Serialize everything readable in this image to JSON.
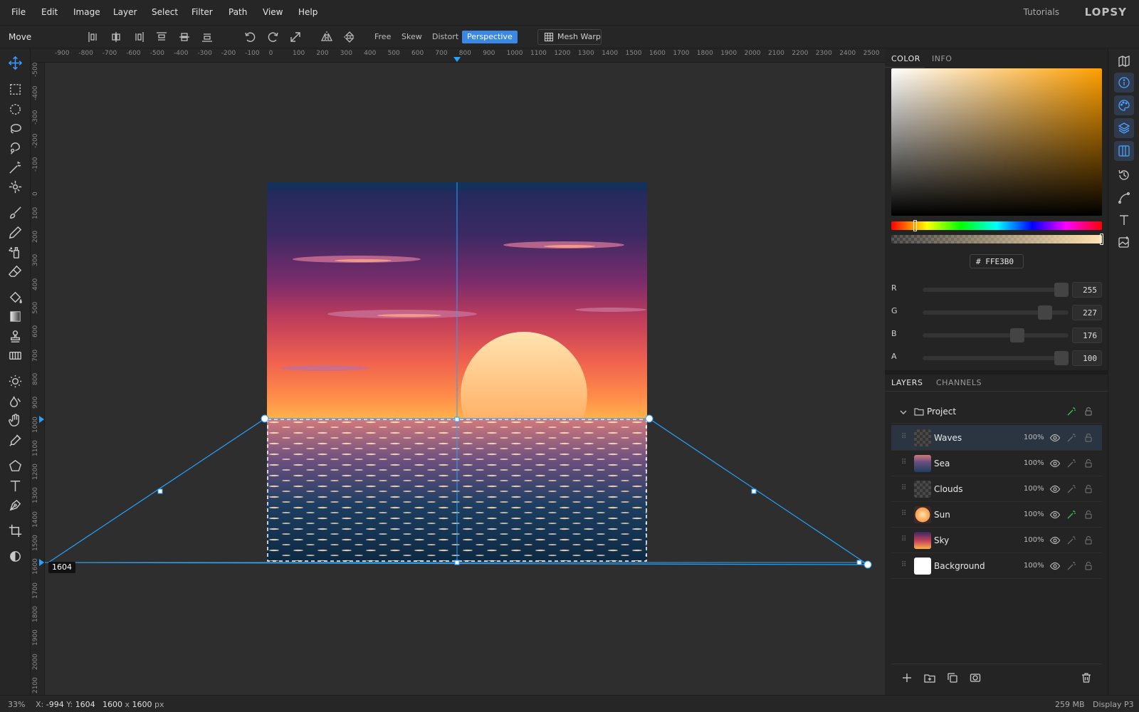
{
  "menu": {
    "items": [
      "File",
      "Edit",
      "Image",
      "Layer",
      "Select",
      "Filter",
      "Path",
      "View",
      "Help"
    ],
    "tutorials": "Tutorials",
    "logo": "LOPSY"
  },
  "options": {
    "tool_name": "Move",
    "modes": [
      "Free",
      "Skew",
      "Distort",
      "Perspective"
    ],
    "active_mode": "Perspective",
    "mesh_warp": "Mesh Warp"
  },
  "rulers": {
    "top": [
      "-900",
      "-800",
      "-700",
      "-600",
      "-500",
      "-400",
      "-300",
      "-200",
      "-100",
      "0",
      "100",
      "200",
      "300",
      "400",
      "500",
      "600",
      "700",
      "800",
      "900",
      "1000",
      "1100",
      "1200",
      "1300",
      "1400",
      "1500",
      "1600",
      "1700",
      "1800",
      "1900",
      "2000",
      "2100",
      "2200",
      "2300",
      "2400",
      "2500"
    ],
    "left": [
      "-500",
      "-400",
      "-300",
      "-200",
      "-100",
      "0",
      "100",
      "200",
      "300",
      "400",
      "500",
      "600",
      "700",
      "800",
      "900",
      "1000",
      "1100",
      "1200",
      "1300",
      "1400",
      "1500",
      "1600",
      "1700",
      "1800",
      "1900",
      "2000",
      "2100"
    ]
  },
  "canvas": {
    "guide_label": "1604"
  },
  "color_panel": {
    "tabs": [
      "COLOR",
      "INFO"
    ],
    "hex_prefix": "#",
    "hex": "FFE3B0",
    "channels": [
      {
        "label": "R",
        "value": "255",
        "fraction": 0.95
      },
      {
        "label": "G",
        "value": "227",
        "fraction": 0.84
      },
      {
        "label": "B",
        "value": "176",
        "fraction": 0.65
      },
      {
        "label": "A",
        "value": "100",
        "fraction": 0.95
      }
    ],
    "hue_fraction": 0.11,
    "colors": {
      "current": "#ffe3b0",
      "accent": "#3b87e6"
    }
  },
  "layers_panel": {
    "tabs": [
      "LAYERS",
      "CHANNELS"
    ],
    "group": "Project",
    "layers": [
      {
        "name": "Waves",
        "opacity": "100%",
        "selected": true
      },
      {
        "name": "Sea",
        "opacity": "100%",
        "selected": false
      },
      {
        "name": "Clouds",
        "opacity": "100%",
        "selected": false
      },
      {
        "name": "Sun",
        "opacity": "100%",
        "selected": false
      },
      {
        "name": "Sky",
        "opacity": "100%",
        "selected": false
      },
      {
        "name": "Background",
        "opacity": "100%",
        "selected": false
      }
    ]
  },
  "status": {
    "zoom": "33%",
    "coords_x_label": "X:",
    "coords_x": "-994",
    "coords_y_label": "Y:",
    "coords_y": "1604",
    "doc_w": "1600",
    "doc_x": "x",
    "doc_h": "1600",
    "doc_unit": "px",
    "memory": "259 MB",
    "display": "Display P3"
  }
}
